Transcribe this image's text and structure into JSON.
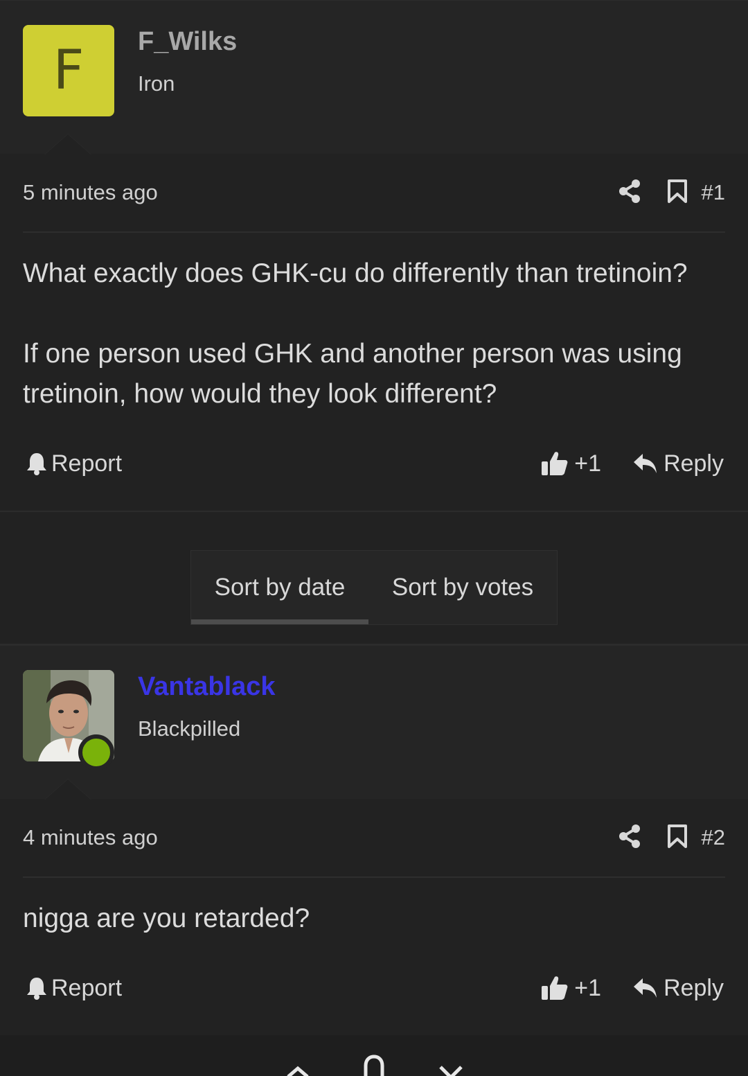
{
  "posts": [
    {
      "avatar_letter": "F",
      "avatar_color": "#cfcf33",
      "username": "F_Wilks",
      "username_color": "#a8a8a8",
      "user_title": "Iron",
      "time": "5 minutes ago",
      "post_number": "#1",
      "body": [
        "What exactly does GHK-cu do differently than tretinoin?",
        "If one person used GHK and another person was using tretinoin, how would they look different?"
      ],
      "report_label": "Report",
      "vote_label": "+1",
      "reply_label": "Reply"
    },
    {
      "username": "Vantablack",
      "username_color": "#3a35e6",
      "user_title": "Blackpilled",
      "online": true,
      "time": "4 minutes ago",
      "post_number": "#2",
      "body": [
        "nigga are you retarded?"
      ],
      "report_label": "Report",
      "vote_label": "+1",
      "reply_label": "Reply"
    }
  ],
  "sort": {
    "options": [
      "Sort by date",
      "Sort by votes"
    ],
    "active": "Sort by date"
  },
  "icons": [
    "share-icon",
    "bookmark-icon",
    "bell-icon",
    "thumbs-up-icon",
    "reply-arrow-icon",
    "chevron-up-icon",
    "bell-outline-icon",
    "close-icon"
  ]
}
